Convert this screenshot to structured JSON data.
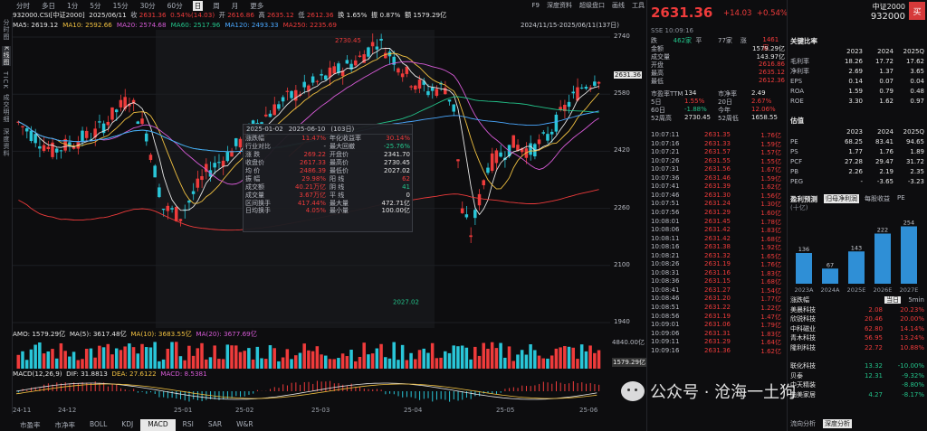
{
  "left_rail": [
    "分时图",
    "K线图",
    "TICK",
    "成交明细",
    "深度资料"
  ],
  "period_tabs": [
    "分时",
    "多日",
    "1分",
    "5分",
    "15分",
    "30分",
    "60分",
    "日",
    "周",
    "月",
    "更多"
  ],
  "period_active": 7,
  "top_right": [
    "F9",
    "深度资料",
    "超级盘口",
    "画线",
    "工具"
  ],
  "quote": {
    "symbol": "932000.CSI[中证2000]",
    "date": "2025/06/11",
    "close_label": "收",
    "close": "2631.36",
    "chg": "0.54%(14.03)",
    "open_label": "开",
    "open": "2616.86",
    "high_label": "高",
    "high": "2635.12",
    "low_label": "低",
    "low": "2612.36",
    "turnover": "换 1.65%",
    "amp": "振 0.87%",
    "amount": "额 1579.29亿"
  },
  "ma": [
    {
      "label": "MA5",
      "value": "2619.12",
      "color": "#e6e6e6"
    },
    {
      "label": "MA10",
      "value": "2592.66",
      "color": "#f0c040"
    },
    {
      "label": "MA20",
      "value": "2574.68",
      "color": "#d65ad6"
    },
    {
      "label": "MA60",
      "value": "2517.96",
      "color": "#23c38a"
    },
    {
      "label": "MA120",
      "value": "2493.33",
      "color": "#4aa8ff"
    },
    {
      "label": "MA250",
      "value": "2235.69",
      "color": "#ef3b3b"
    }
  ],
  "range_text": "2024/11/15-2025/06/11(137日)",
  "price_ticks": [
    "2740",
    "2580",
    "2420",
    "2260",
    "2100",
    "1940"
  ],
  "current_price_tag": "2631.36",
  "peak_label": "2730.45",
  "trough_label": "2027.02",
  "stats": {
    "from": "2025-01-02",
    "to": "2025-06-10",
    "days": "(103日)",
    "rows": [
      [
        "涨跌幅",
        "11.47%",
        "年化收益率",
        "30.14%"
      ],
      [
        "行业对比",
        "-",
        "最大回撤",
        "-25.76%"
      ],
      [
        "涨 跌",
        "269.22",
        "开盘价",
        "2341.70"
      ],
      [
        "收盘价",
        "2617.33",
        "最高价",
        "2730.45"
      ],
      [
        "均 价",
        "2486.39",
        "最低价",
        "2027.02"
      ],
      [
        "振 幅",
        "29.98%",
        "阳 线",
        "62"
      ],
      [
        "成交额",
        "40.21万亿",
        "阴 线",
        "41"
      ],
      [
        "成交量",
        "3.67万亿",
        "平 线",
        "0"
      ],
      [
        "区间换手",
        "417.44%",
        "最大量",
        "472.71亿"
      ],
      [
        "日均换手",
        "4.05%",
        "最小量",
        "100.00亿"
      ]
    ]
  },
  "volume": {
    "label": "AMO: 1579.29亿",
    "ma5": "MA(5): 3617.48亿",
    "ma10": "MA(10): 3683.55亿",
    "ma20": "MA(20): 3677.69亿",
    "axis_top": "4840.00亿",
    "axis_cur": "1579.29亿"
  },
  "macd": {
    "label": "MACD(12,26,9)",
    "dif": "DIF: 31.8813",
    "dea": "DEA: 27.6122",
    "macd": "MACD: 8.5381"
  },
  "date_ticks": [
    "24-11",
    "24-12",
    "25-01",
    "25-02",
    "25-03",
    "25-04",
    "25-05",
    "25-06"
  ],
  "bottom_tabs": [
    "市盈率",
    "市净率",
    "BOLL",
    "KDJ",
    "MACD",
    "RSI",
    "SAR",
    "W&R"
  ],
  "bottom_active": 4,
  "mid": {
    "f9": "F9",
    "price": "2631.36",
    "chg": "+14.03",
    "pct": "+0.54%",
    "sse": "SSE 10:09:16",
    "ask": [
      "跌",
      "462家",
      "平",
      "77家",
      "涨",
      "1461家"
    ],
    "kv": [
      [
        "金额",
        "1579.29亿"
      ],
      [
        "成交量",
        "143.97亿"
      ],
      [
        "开盘",
        "2616.86"
      ],
      [
        "最高",
        "2635.12"
      ],
      [
        "最低",
        "2612.36"
      ]
    ],
    "kv2": [
      [
        "市盈率TTM",
        "134",
        "市净率",
        "2.49"
      ],
      [
        "5日",
        "1.55%",
        "20日",
        "2.67%"
      ],
      [
        "60日",
        "-1.88%",
        "今年",
        "12.06%"
      ],
      [
        "52周高",
        "2730.45",
        "52周低",
        "1658.55"
      ]
    ],
    "ticks": [
      [
        "10:07:11",
        "2631.35",
        "1.76亿"
      ],
      [
        "10:07:16",
        "2631.33",
        "1.59亿"
      ],
      [
        "10:07:21",
        "2631.57",
        "1.57亿"
      ],
      [
        "10:07:26",
        "2631.55",
        "1.55亿"
      ],
      [
        "10:07:31",
        "2631.56",
        "1.67亿"
      ],
      [
        "10:07:36",
        "2631.46",
        "1.59亿"
      ],
      [
        "10:07:41",
        "2631.39",
        "1.62亿"
      ],
      [
        "10:07:46",
        "2631.30",
        "1.56亿"
      ],
      [
        "10:07:51",
        "2631.24",
        "1.30亿"
      ],
      [
        "10:07:56",
        "2631.29",
        "1.60亿"
      ],
      [
        "10:08:01",
        "2631.45",
        "1.78亿"
      ],
      [
        "10:08:06",
        "2631.42",
        "1.83亿"
      ],
      [
        "10:08:11",
        "2631.42",
        "1.68亿"
      ],
      [
        "10:08:16",
        "2631.38",
        "1.92亿"
      ],
      [
        "10:08:21",
        "2631.32",
        "1.65亿"
      ],
      [
        "10:08:26",
        "2631.19",
        "1.76亿"
      ],
      [
        "10:08:31",
        "2631.16",
        "1.83亿"
      ],
      [
        "10:08:36",
        "2631.15",
        "1.68亿"
      ],
      [
        "10:08:41",
        "2631.27",
        "1.54亿"
      ],
      [
        "10:08:46",
        "2631.20",
        "1.77亿"
      ],
      [
        "10:08:51",
        "2631.22",
        "1.22亿"
      ],
      [
        "10:08:56",
        "2631.19",
        "1.47亿"
      ],
      [
        "10:09:01",
        "2631.06",
        "1.79亿"
      ],
      [
        "10:09:06",
        "2631.31",
        "1.83亿"
      ],
      [
        "10:09:11",
        "2631.29",
        "1.64亿"
      ],
      [
        "10:09:16",
        "2631.36",
        "1.62亿"
      ]
    ]
  },
  "right": {
    "name": "中证2000",
    "code": "932000",
    "buy": "买",
    "ratio_title": "关键比率",
    "ratio_years": [
      "2023",
      "2024",
      "2025Q"
    ],
    "ratios": [
      [
        "毛利率",
        "18.26",
        "17.72",
        "17.62"
      ],
      [
        "净利率",
        "2.69",
        "1.37",
        "3.65"
      ],
      [
        "EPS",
        "0.14",
        "0.07",
        "0.04"
      ],
      [
        "ROA",
        "1.59",
        "0.79",
        "0.48"
      ],
      [
        "ROE",
        "3.30",
        "1.62",
        "0.97"
      ]
    ],
    "val_title": "估值",
    "val_years": [
      "2023",
      "2024",
      "2025Q"
    ],
    "vals": [
      [
        "PE",
        "68.25",
        "83.41",
        "94.65"
      ],
      [
        "PS",
        "1.77",
        "1.76",
        "1.89"
      ],
      [
        "PCF",
        "27.28",
        "29.47",
        "31.72"
      ],
      [
        "PB",
        "2.26",
        "2.19",
        "2.35"
      ],
      [
        "PEG",
        "-",
        "-3.65",
        "-3.23"
      ]
    ],
    "earn_title": "盈利预测",
    "earn_tabs": [
      "归母净利润",
      "每股收益",
      "PE"
    ],
    "earn_unit": "(十亿)",
    "earn_chart": {
      "type": "bar",
      "categories": [
        "2023A",
        "2024A",
        "2025E",
        "2026E",
        "2027E"
      ],
      "values": [
        136,
        67,
        143,
        222,
        254
      ]
    },
    "sector_title": "涨跌幅",
    "sector_btns": [
      "当日",
      "5min"
    ],
    "sectors": [
      [
        "美晨科技",
        "2.08",
        "20.23%"
      ],
      [
        "欣锐科技",
        "20.46",
        "20.00%"
      ],
      [
        "中科磁业",
        "62.80",
        "14.14%"
      ],
      [
        "青木科技",
        "56.95",
        "13.24%"
      ],
      [
        "隆利科技",
        "22.72",
        "10.88%"
      ],
      [
        "",
        "",
        ""
      ],
      [
        "联化科技",
        "13.32",
        "-10.00%"
      ],
      [
        "贝泰",
        "12.31",
        "-9.32%"
      ],
      [
        "中天精装",
        "",
        "-8.80%"
      ],
      [
        "曲美家居",
        "4.27",
        "-8.17%"
      ]
    ],
    "bottom": [
      "流向分析",
      "深度分析"
    ]
  },
  "watermark": "公众号 · 沧海一土狗"
}
